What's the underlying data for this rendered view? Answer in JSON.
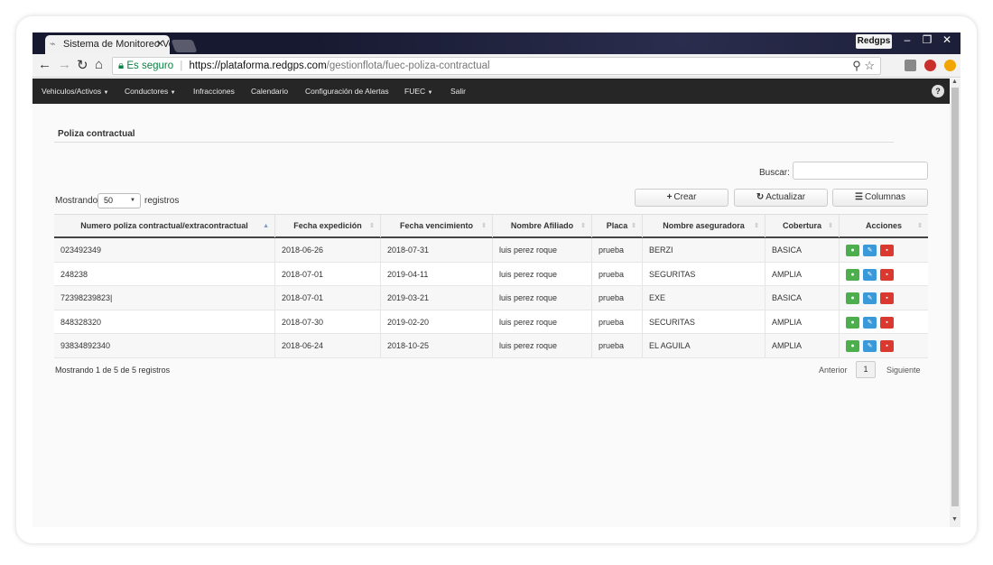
{
  "browser": {
    "tab_title": "Sistema de Monitoreo Ve",
    "tab_close": "✕",
    "profile": "Redgps",
    "secure_label": "Es seguro",
    "url_host": "https://plataforma.redgps.com",
    "url_path": "/gestionflota/fuec-poliza-contractual"
  },
  "nav": {
    "items": [
      {
        "label": "Vehiculos/Activos",
        "caret": "▼"
      },
      {
        "label": "Conductores",
        "caret": "▼"
      },
      {
        "label": "Infracciones",
        "caret": ""
      },
      {
        "label": "Calendario",
        "caret": ""
      },
      {
        "label": "Configuración de Alertas",
        "caret": ""
      },
      {
        "label": "FUEC",
        "caret": "▼"
      },
      {
        "label": "Salir",
        "caret": ""
      }
    ],
    "help": "?"
  },
  "page": {
    "title": "Poliza contractual",
    "search_label": "Buscar:",
    "search_value": "",
    "show_label": "Mostrando",
    "page_size": "50",
    "records_label": "registros",
    "buttons": {
      "create": "Crear",
      "refresh": "Actualizar",
      "columns": "Columnas"
    }
  },
  "table": {
    "columns": [
      "Numero poliza contractual/extracontractual",
      "Fecha expedición",
      "Fecha vencimiento",
      "Nombre Afiliado",
      "Placa",
      "Nombre aseguradora",
      "Cobertura",
      "Acciones"
    ],
    "rows": [
      [
        "023492349",
        "2018-06-26",
        "2018-07-31",
        "luis perez roque",
        "prueba",
        "BERZI",
        "BASICA"
      ],
      [
        "248238",
        "2018-07-01",
        "2019-04-11",
        "luis perez roque",
        "prueba",
        "SEGURITAS",
        "AMPLIA"
      ],
      [
        "72398239823|",
        "2018-07-01",
        "2019-03-21",
        "luis perez roque",
        "prueba",
        "EXE",
        "BASICA"
      ],
      [
        "848328320",
        "2018-07-30",
        "2019-02-20",
        "luis perez roque",
        "prueba",
        "SECURITAS",
        "AMPLIA"
      ],
      [
        "93834892340",
        "2018-06-24",
        "2018-10-25",
        "luis perez roque",
        "prueba",
        "EL AGUILA",
        "AMPLIA"
      ]
    ]
  },
  "footer": {
    "info": "Mostrando 1 de 5 de 5 registros",
    "prev": "Anterior",
    "page": "1",
    "next": "Siguiente"
  },
  "colors": {
    "view": "#4cae4c",
    "edit": "#3a9ad9",
    "delete": "#d9392f",
    "navbar": "#262626"
  }
}
